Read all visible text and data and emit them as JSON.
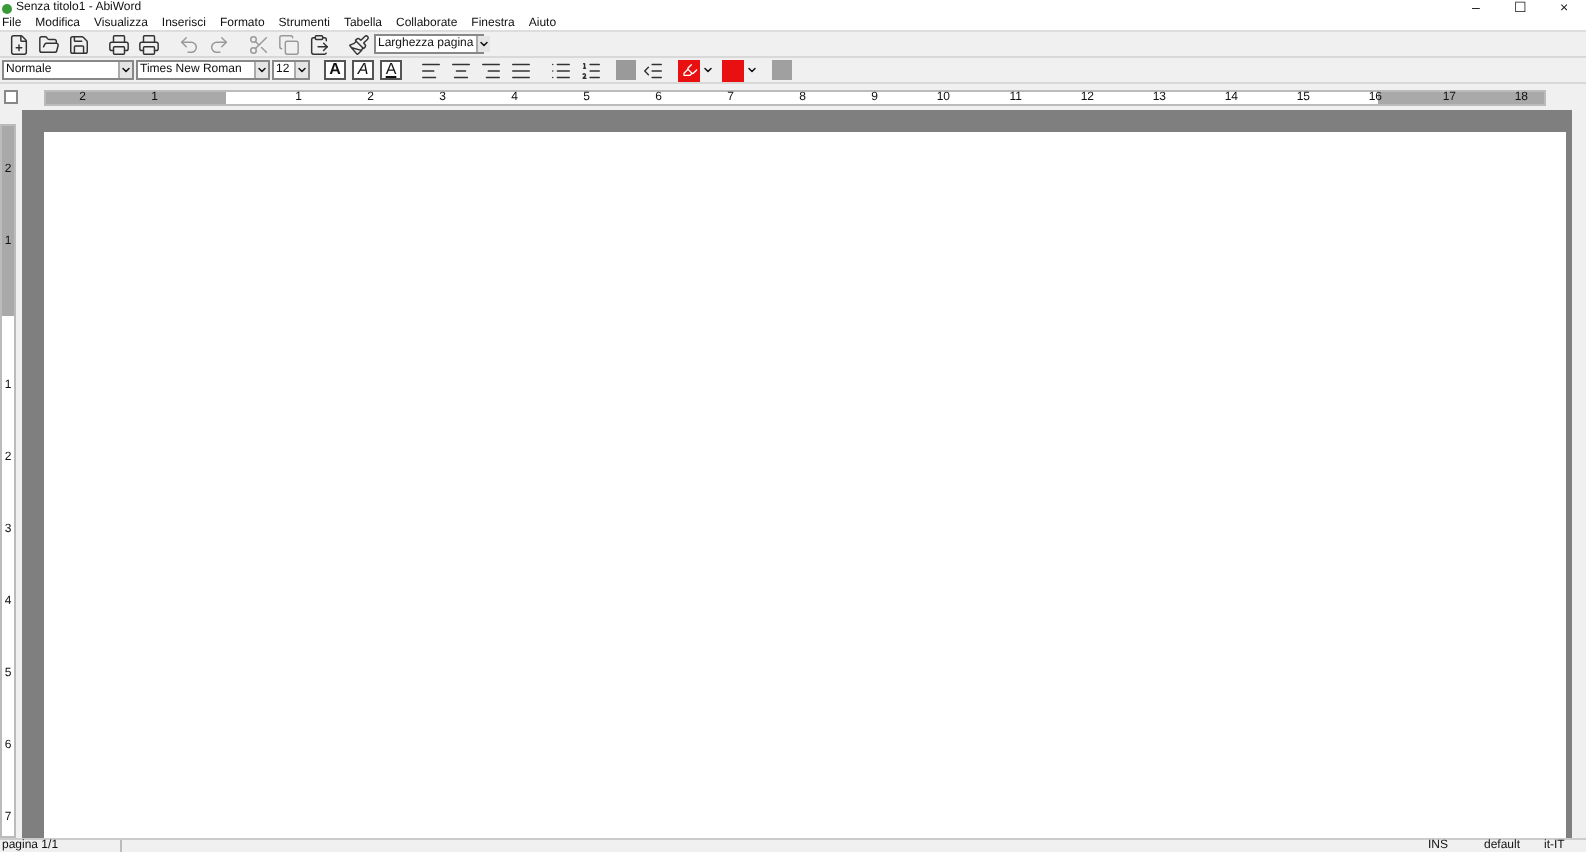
{
  "window": {
    "title": "Senza titolo1 - AbiWord",
    "controls": [
      "–",
      "☐",
      "×"
    ]
  },
  "menu": [
    "File",
    "Modifica",
    "Visualizza",
    "Inserisci",
    "Formato",
    "Strumenti",
    "Tabella",
    "Collaborate",
    "Finestra",
    "Aiuto"
  ],
  "zoom": {
    "value": "Larghezza pagina"
  },
  "format_bar": {
    "style": "Normale",
    "font": "Times New Roman",
    "size": "12",
    "text_buttons": [
      {
        "kind": "bold",
        "label": "A"
      },
      {
        "kind": "italic",
        "label": "A"
      },
      {
        "kind": "underline",
        "label": "A"
      }
    ]
  },
  "top_ruler": {
    "left_margin_labels": [
      "2",
      "1"
    ],
    "labels": [
      "1",
      "2",
      "3",
      "4",
      "5",
      "6",
      "7",
      "8",
      "9",
      "10",
      "11",
      "12",
      "13",
      "14",
      "15"
    ],
    "right_margin_labels": [
      "16",
      "17",
      "18"
    ]
  },
  "side_ruler": {
    "top_margin_labels": [
      "2",
      "1"
    ],
    "labels": [
      "1",
      "2",
      "3",
      "4",
      "5",
      "6",
      "7"
    ]
  },
  "status_bar": {
    "page": "pagina 1/1",
    "mode": "INS",
    "style": "default",
    "language": "it-IT"
  }
}
